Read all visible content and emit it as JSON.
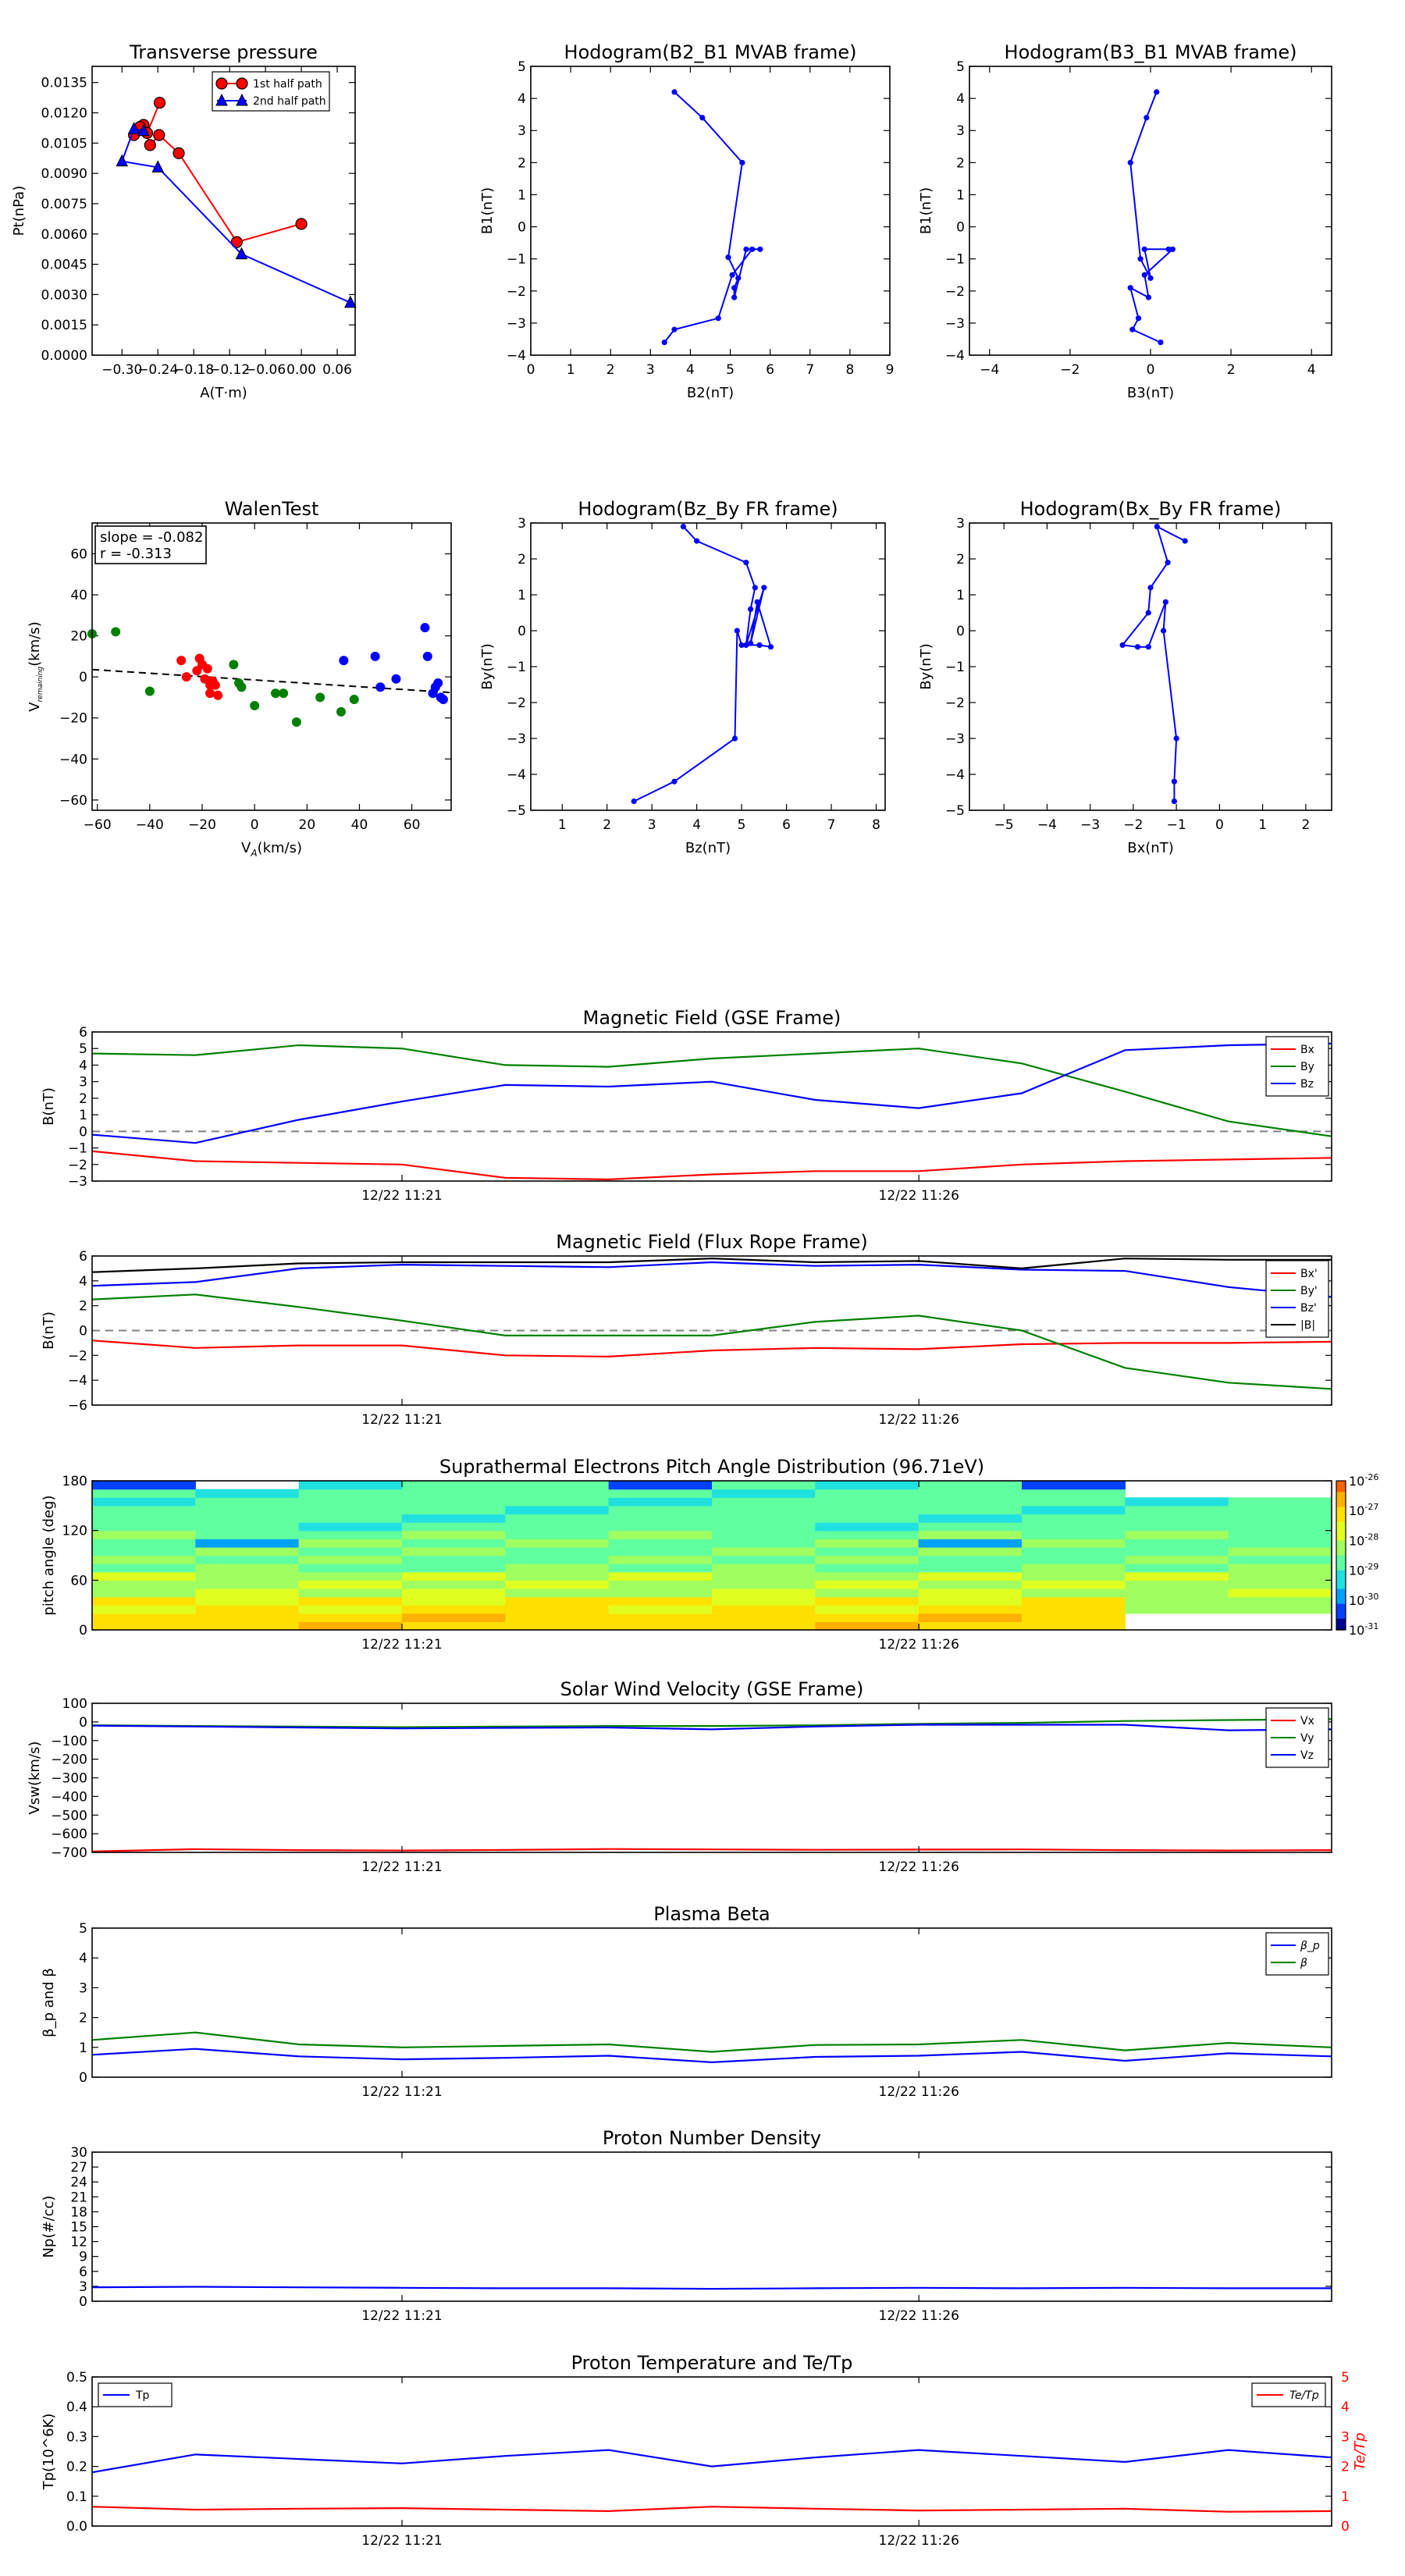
{
  "colors": {
    "red": "#ff0000",
    "green": "#008000",
    "blue": "#0000ff",
    "black": "#000000",
    "gray": "#808080"
  },
  "time_ticks": [
    "12/22 11:21",
    "12/22 11:26"
  ],
  "chart_data": [
    {
      "id": "tp",
      "type": "line",
      "title": "Transverse pressure",
      "xlabel": "A(T·m)",
      "ylabel": "Pt(nPa)",
      "xlim": [
        -0.35,
        0.09
      ],
      "ylim": [
        0,
        0.0143
      ],
      "xticks": [
        -0.3,
        -0.24,
        -0.18,
        -0.12,
        -0.06,
        0.0,
        0.06
      ],
      "xticklabels": [
        "−0.30",
        "−0.24",
        "−0.18",
        "−0.12",
        "−0.06",
        "0.00",
        "0.06"
      ],
      "yticks": [
        0,
        0.0015,
        0.003,
        0.0045,
        0.006,
        0.0075,
        0.009,
        0.0105,
        0.012,
        0.0135
      ],
      "yticklabels": [
        "0.0000",
        "0.0015",
        "0.0030",
        "0.0045",
        "0.0060",
        "0.0075",
        "0.0090",
        "0.0105",
        "0.0120",
        "0.0135"
      ],
      "legend": "top-center",
      "series": [
        {
          "name": "1st half path",
          "color": "#ff0000",
          "marker": "circle",
          "x": [
            0.0,
            -0.108,
            -0.205,
            -0.238,
            -0.253,
            -0.264,
            -0.28,
            -0.27,
            -0.258,
            -0.237
          ],
          "y": [
            0.0065,
            0.0056,
            0.01,
            0.0109,
            0.0104,
            0.0114,
            0.0109,
            0.0113,
            0.011,
            0.0125
          ]
        },
        {
          "name": "2nd half path",
          "color": "#0000ff",
          "marker": "triangle",
          "x": [
            0.082,
            -0.1,
            -0.24,
            -0.3,
            -0.28,
            -0.264
          ],
          "y": [
            0.0026,
            0.005,
            0.0093,
            0.0096,
            0.0112,
            0.0111
          ]
        }
      ]
    },
    {
      "id": "h1",
      "type": "line",
      "title": "Hodogram(B2_B1 MVAB frame)",
      "xlabel": "B2(nT)",
      "ylabel": "B1(nT)",
      "xlim": [
        0,
        9
      ],
      "ylim": [
        -4,
        5
      ],
      "xticks": [
        0,
        1,
        2,
        3,
        4,
        5,
        6,
        7,
        8,
        9
      ],
      "xticklabels": [
        "0",
        "1",
        "2",
        "3",
        "4",
        "5",
        "6",
        "7",
        "8",
        "9"
      ],
      "yticks": [
        -4,
        -3,
        -2,
        -1,
        0,
        1,
        2,
        3,
        4,
        5
      ],
      "yticklabels": [
        "−4",
        "−3",
        "−2",
        "−1",
        "0",
        "1",
        "2",
        "3",
        "4",
        "5"
      ],
      "series": [
        {
          "name": "",
          "color": "#0000ff",
          "marker": "dot",
          "x": [
            3.6,
            4.3,
            5.3,
            4.95,
            5.2,
            5.1,
            5.1,
            5.4,
            5.75,
            5.55,
            5.05,
            4.7,
            3.6,
            3.35
          ],
          "y": [
            4.2,
            3.4,
            2.0,
            -0.95,
            -1.6,
            -1.9,
            -2.2,
            -0.7,
            -0.7,
            -0.7,
            -1.5,
            -2.85,
            -3.2,
            -3.6
          ]
        }
      ]
    },
    {
      "id": "h2",
      "type": "line",
      "title": "Hodogram(B3_B1 MVAB frame)",
      "xlabel": "B3(nT)",
      "ylabel": "B1(nT)",
      "xlim": [
        -4.5,
        4.5
      ],
      "ylim": [
        -4,
        5
      ],
      "xticks": [
        -4,
        -2,
        0,
        2,
        4
      ],
      "xticklabels": [
        "−4",
        "−2",
        "0",
        "2",
        "4"
      ],
      "yticks": [
        -4,
        -3,
        -2,
        -1,
        0,
        1,
        2,
        3,
        4,
        5
      ],
      "yticklabels": [
        "−4",
        "−3",
        "−2",
        "−1",
        "0",
        "1",
        "2",
        "3",
        "4",
        "5"
      ],
      "series": [
        {
          "name": "",
          "color": "#0000ff",
          "marker": "dot",
          "x": [
            0.15,
            -0.1,
            -0.5,
            -0.25,
            0.0,
            -0.15,
            0.45,
            0.55,
            -0.15,
            -0.05,
            -0.5,
            -0.3,
            -0.45,
            0.25
          ],
          "y": [
            4.2,
            3.4,
            2.0,
            -1.0,
            -1.6,
            -0.7,
            -0.7,
            -0.7,
            -1.5,
            -2.2,
            -1.9,
            -2.85,
            -3.2,
            -3.6
          ]
        }
      ]
    },
    {
      "id": "walen",
      "type": "scatter",
      "title": "WalenTest",
      "xlabel": "V_A(km/s)",
      "ylabel": "V_remaining(km/s)",
      "xlim": [
        -62,
        75
      ],
      "ylim": [
        -65,
        75
      ],
      "xticks": [
        -60,
        -40,
        -20,
        0,
        20,
        40,
        60
      ],
      "xticklabels": [
        "−60",
        "−40",
        "−20",
        "0",
        "20",
        "40",
        "60"
      ],
      "yticks": [
        -60,
        -40,
        -20,
        0,
        20,
        40,
        60
      ],
      "yticklabels": [
        "−60",
        "−40",
        "−20",
        "0",
        "20",
        "40",
        "60"
      ],
      "annotation": [
        "slope = -0.082",
        "r = -0.313"
      ],
      "fit": {
        "slope": -0.082,
        "intercept": -1.5
      },
      "groups": [
        {
          "color": "#ff0000",
          "x": [
            -28,
            -26,
            -22,
            -21,
            -20,
            -19,
            -18,
            -17,
            -17,
            -16,
            -15,
            -14
          ],
          "y": [
            8,
            0,
            3,
            9,
            6,
            -1,
            4,
            -4,
            -8,
            -2,
            -4,
            -9
          ]
        },
        {
          "color": "#008000",
          "x": [
            -62,
            -53,
            -40,
            -8,
            -6,
            -5,
            0,
            8,
            11,
            25,
            33,
            38,
            16
          ],
          "y": [
            21,
            22,
            -7,
            6,
            -3,
            -5,
            -14,
            -8,
            -8,
            -10,
            -17,
            -11,
            -22
          ]
        },
        {
          "color": "#0000ff",
          "x": [
            34,
            46,
            48,
            54,
            65,
            66,
            68,
            69,
            70,
            71,
            72,
            76
          ],
          "y": [
            8,
            10,
            -5,
            -1,
            24,
            10,
            -8,
            -5,
            -3,
            -10,
            -11,
            -16
          ]
        }
      ]
    },
    {
      "id": "h3",
      "type": "line",
      "title": "Hodogram(Bz_By FR frame)",
      "xlabel": "Bz(nT)",
      "ylabel": "By(nT)",
      "xlim": [
        0.3,
        8.2
      ],
      "ylim": [
        -5,
        3
      ],
      "xticks": [
        1,
        2,
        3,
        4,
        5,
        6,
        7,
        8
      ],
      "xticklabels": [
        "1",
        "2",
        "3",
        "4",
        "5",
        "6",
        "7",
        "8"
      ],
      "yticks": [
        -5,
        -4,
        -3,
        -2,
        -1,
        0,
        1,
        2,
        3
      ],
      "yticklabels": [
        "−5",
        "−4",
        "−3",
        "−2",
        "−1",
        "0",
        "1",
        "2",
        "3"
      ],
      "series": [
        {
          "name": "",
          "color": "#0000ff",
          "marker": "dot",
          "x": [
            3.7,
            4.0,
            5.1,
            5.3,
            5.2,
            5.1,
            5.5,
            5.2,
            5.35,
            5.65,
            5.4,
            5.0,
            4.9,
            4.85,
            3.5,
            2.6
          ],
          "y": [
            2.9,
            2.5,
            1.9,
            1.2,
            0.6,
            -0.4,
            1.2,
            -0.35,
            0.8,
            -0.45,
            -0.4,
            -0.4,
            0.0,
            -3.0,
            -4.2,
            -4.75
          ]
        }
      ]
    },
    {
      "id": "h4",
      "type": "line",
      "title": "Hodogram(Bx_By FR frame)",
      "xlabel": "Bx(nT)",
      "ylabel": "By(nT)",
      "xlim": [
        -5.8,
        2.6
      ],
      "ylim": [
        -5,
        3
      ],
      "xticks": [
        -5,
        -4,
        -3,
        -2,
        -1,
        0,
        1,
        2
      ],
      "xticklabels": [
        "−5",
        "−4",
        "−3",
        "−2",
        "−1",
        "0",
        "1",
        "2"
      ],
      "yticks": [
        -5,
        -4,
        -3,
        -2,
        -1,
        0,
        1,
        2,
        3
      ],
      "yticklabels": [
        "−5",
        "−4",
        "−3",
        "−2",
        "−1",
        "0",
        "1",
        "2",
        "3"
      ],
      "series": [
        {
          "name": "",
          "color": "#0000ff",
          "marker": "dot",
          "x": [
            -0.8,
            -1.45,
            -1.2,
            -1.6,
            -1.65,
            -2.25,
            -1.9,
            -1.65,
            -1.25,
            -1.3,
            -1.0,
            -1.05,
            -1.05
          ],
          "y": [
            2.5,
            2.9,
            1.9,
            1.2,
            0.5,
            -0.4,
            -0.45,
            -0.45,
            0.8,
            0.0,
            -3.0,
            -4.2,
            -4.75
          ]
        }
      ]
    },
    {
      "id": "mag_gse",
      "type": "line",
      "title": "Magnetic Field (GSE Frame)",
      "ylabel": "B(nT)",
      "ylim": [
        -3,
        6
      ],
      "yticks": [
        -3,
        -2,
        -1,
        0,
        1,
        2,
        3,
        4,
        5,
        6
      ],
      "yticklabels": [
        "−3",
        "−2",
        "−1",
        "0",
        "1",
        "2",
        "3",
        "4",
        "5",
        "6"
      ],
      "legend": "top-right",
      "zero_line": true,
      "series": [
        {
          "name": "Bx",
          "color": "#ff0000",
          "values": [
            -1.2,
            -1.8,
            -1.9,
            -2.0,
            -2.8,
            -2.9,
            -2.6,
            -2.4,
            -2.4,
            -2.0,
            -1.8,
            -1.7,
            -1.6
          ]
        },
        {
          "name": "By",
          "color": "#008000",
          "values": [
            4.7,
            4.6,
            5.2,
            5.0,
            4.0,
            3.9,
            4.4,
            4.7,
            5.0,
            4.1,
            2.4,
            0.6,
            -0.3
          ]
        },
        {
          "name": "Bz",
          "color": "#0000ff",
          "values": [
            -0.2,
            -0.7,
            0.7,
            1.8,
            2.8,
            2.7,
            3.0,
            1.9,
            1.4,
            2.3,
            4.9,
            5.2,
            5.3
          ]
        }
      ]
    },
    {
      "id": "mag_fr",
      "type": "line",
      "title": "Magnetic Field (Flux Rope Frame)",
      "ylabel": "B(nT)",
      "ylim": [
        -6,
        6
      ],
      "yticks": [
        -6,
        -4,
        -2,
        0,
        2,
        4,
        6
      ],
      "yticklabels": [
        "−6",
        "−4",
        "−2",
        "0",
        "2",
        "4",
        "6"
      ],
      "legend": "top-right",
      "zero_line": true,
      "series": [
        {
          "name": "Bx'",
          "color": "#ff0000",
          "values": [
            -0.8,
            -1.4,
            -1.2,
            -1.2,
            -2.0,
            -2.1,
            -1.6,
            -1.4,
            -1.5,
            -1.1,
            -1.0,
            -1.0,
            -0.9
          ]
        },
        {
          "name": "By'",
          "color": "#008000",
          "values": [
            2.5,
            2.9,
            1.9,
            0.8,
            -0.4,
            -0.4,
            -0.4,
            0.7,
            1.2,
            0.0,
            -3.0,
            -4.2,
            -4.7
          ]
        },
        {
          "name": "Bz'",
          "color": "#0000ff",
          "values": [
            3.6,
            3.9,
            5.0,
            5.3,
            5.2,
            5.1,
            5.5,
            5.2,
            5.3,
            4.9,
            4.8,
            3.5,
            2.7
          ]
        },
        {
          "name": "|B|",
          "color": "#000000",
          "values": [
            4.7,
            5.0,
            5.4,
            5.5,
            5.5,
            5.5,
            5.8,
            5.5,
            5.6,
            5.0,
            5.8,
            5.7,
            5.7
          ]
        }
      ]
    },
    {
      "id": "pad",
      "type": "heatmap",
      "title": "Suprathermal Electrons Pitch Angle Distribution (96.71eV)",
      "ylabel": "pitch angle (deg)",
      "ylim": [
        0,
        180
      ],
      "yticks": [
        0,
        60,
        120,
        180
      ],
      "yticklabels": [
        "0",
        "60",
        "120",
        "180"
      ],
      "colorbar": {
        "ticks": [
          "10^-26",
          "10^-27",
          "10^-28",
          "10^-29",
          "10^-30",
          "10^-31"
        ]
      },
      "columns": 12
    },
    {
      "id": "vsw",
      "type": "line",
      "title": "Solar Wind Velocity (GSE Frame)",
      "ylabel": "Vsw(km/s)",
      "ylim": [
        -700,
        100
      ],
      "yticks": [
        -700,
        -600,
        -500,
        -400,
        -300,
        -200,
        -100,
        0,
        100
      ],
      "yticklabels": [
        "−700",
        "−600",
        "−500",
        "−400",
        "−300",
        "−200",
        "−100",
        "0",
        "100"
      ],
      "legend": "top-right",
      "series": [
        {
          "name": "Vx",
          "color": "#ff0000",
          "values": [
            -695,
            -683,
            -688,
            -690,
            -687,
            -682,
            -684,
            -686,
            -685,
            -684,
            -688,
            -690,
            -688
          ]
        },
        {
          "name": "Vy",
          "color": "#008000",
          "values": [
            -18,
            -22,
            -25,
            -28,
            -25,
            -22,
            -22,
            -18,
            -10,
            -5,
            5,
            10,
            15
          ]
        },
        {
          "name": "Vz",
          "color": "#0000ff",
          "values": [
            -20,
            -25,
            -30,
            -35,
            -32,
            -30,
            -40,
            -25,
            -15,
            -15,
            -15,
            -45,
            -40
          ]
        }
      ]
    },
    {
      "id": "beta",
      "type": "line",
      "title": "Plasma Beta",
      "ylabel": "β_p and β",
      "ylim": [
        0,
        5
      ],
      "yticks": [
        0,
        1,
        2,
        3,
        4,
        5
      ],
      "yticklabels": [
        "0",
        "1",
        "2",
        "3",
        "4",
        "5"
      ],
      "legend": "top-right",
      "series": [
        {
          "name": "β_p",
          "color": "#0000ff",
          "values": [
            0.75,
            0.95,
            0.7,
            0.6,
            0.65,
            0.72,
            0.5,
            0.68,
            0.72,
            0.85,
            0.55,
            0.8,
            0.7
          ]
        },
        {
          "name": "β",
          "color": "#008000",
          "values": [
            1.25,
            1.5,
            1.1,
            1.0,
            1.05,
            1.1,
            0.85,
            1.08,
            1.1,
            1.25,
            0.9,
            1.15,
            1.0
          ]
        }
      ]
    },
    {
      "id": "np",
      "type": "line",
      "title": "Proton Number Density",
      "ylabel": "Np(#/cc)",
      "ylim": [
        0,
        30
      ],
      "yticks": [
        0,
        3,
        6,
        9,
        12,
        15,
        18,
        21,
        24,
        27,
        30
      ],
      "yticklabels": [
        "0",
        "3",
        "6",
        "9",
        "12",
        "15",
        "18",
        "21",
        "24",
        "27",
        "30"
      ],
      "series": [
        {
          "name": "",
          "color": "#0000ff",
          "values": [
            2.8,
            2.9,
            2.8,
            2.7,
            2.6,
            2.6,
            2.5,
            2.6,
            2.7,
            2.6,
            2.7,
            2.6,
            2.6
          ]
        }
      ]
    },
    {
      "id": "temp",
      "type": "line",
      "title": "Proton Temperature and Te/Tp",
      "ylabel": "Tp(10^6K)",
      "ylim": [
        0,
        0.5
      ],
      "yticks": [
        0,
        0.1,
        0.2,
        0.3,
        0.4,
        0.5
      ],
      "yticklabels": [
        "0.0",
        "0.1",
        "0.2",
        "0.3",
        "0.4",
        "0.5"
      ],
      "y2label": "Te/Tp",
      "y2lim": [
        0,
        5
      ],
      "y2ticks": [
        0,
        1,
        2,
        3,
        4,
        5
      ],
      "y2ticklabels": [
        "0",
        "1",
        "2",
        "3",
        "4",
        "5"
      ],
      "series": [
        {
          "name": "Tp",
          "color": "#0000ff",
          "axis": "left",
          "legend": "top-left",
          "values": [
            0.18,
            0.24,
            0.225,
            0.21,
            0.235,
            0.255,
            0.2,
            0.23,
            0.255,
            0.235,
            0.215,
            0.255,
            0.23
          ]
        },
        {
          "name": "Te/Tp",
          "color": "#ff0000",
          "axis": "right",
          "legend": "top-right",
          "values": [
            0.65,
            0.55,
            0.58,
            0.6,
            0.55,
            0.5,
            0.65,
            0.58,
            0.52,
            0.55,
            0.58,
            0.48,
            0.5
          ]
        }
      ]
    }
  ]
}
